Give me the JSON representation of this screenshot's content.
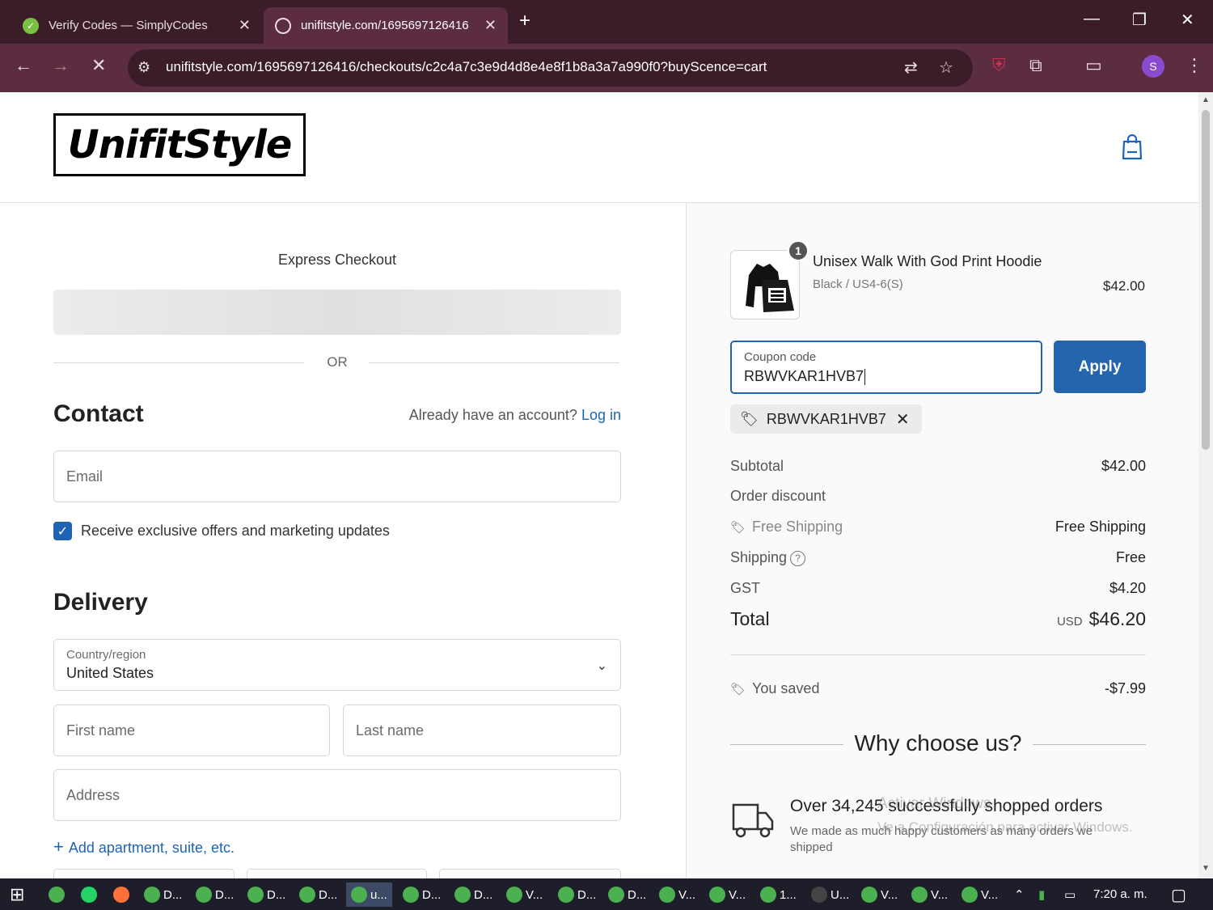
{
  "browser": {
    "tabs": [
      {
        "title": "Verify Codes — SimplyCodes",
        "active": false
      },
      {
        "title": "unifitstyle.com/1695697126416",
        "active": true
      }
    ],
    "new_tab": "+",
    "url": "unifitstyle.com/1695697126416/checkouts/c2c4a7c3e9d4d8e4e8f1b8a3a7a990f0?buyScence=cart",
    "profile_initial": "S"
  },
  "header": {
    "logo_text": "UnifitStyle"
  },
  "checkout": {
    "express_label": "Express Checkout",
    "or_label": "OR",
    "contact_heading": "Contact",
    "login_prompt": "Already have an account?",
    "login_link": "Log in",
    "email_placeholder": "Email",
    "marketing_label": "Receive exclusive offers and marketing updates",
    "delivery_heading": "Delivery",
    "country_label": "Country/region",
    "country_value": "United States",
    "first_name_placeholder": "First name",
    "last_name_placeholder": "Last name",
    "address_placeholder": "Address",
    "add_apartment": "Add apartment, suite, etc."
  },
  "summary": {
    "item": {
      "quantity": "1",
      "name": "Unisex Walk With God Print Hoodie",
      "variant": "Black / US4-6(S)",
      "price": "$42.00"
    },
    "coupon_label": "Coupon code",
    "coupon_value": "RBWVKAR1HVB7",
    "apply_label": "Apply",
    "applied_code": "RBWVKAR1HVB7",
    "subtotal_label": "Subtotal",
    "subtotal_value": "$42.00",
    "order_discount_label": "Order discount",
    "free_shipping_label": "Free Shipping",
    "free_shipping_value": "Free Shipping",
    "shipping_label": "Shipping",
    "shipping_value": "Free",
    "gst_label": "GST",
    "gst_value": "$4.20",
    "total_label": "Total",
    "total_currency": "USD",
    "total_value": "$46.20",
    "saved_label": "You saved",
    "saved_value": "-$7.99",
    "why_heading": "Why choose us?",
    "feature_title": "Over 34,245 successfully shopped orders",
    "feature_desc": "We made as much happy customers as many orders we shipped"
  },
  "overlay": {
    "watermark_line1": "Activar Windows",
    "watermark_line2": "Ve a Configuración para activar Windows."
  },
  "taskbar": {
    "items": [
      "D...",
      "D...",
      "D...",
      "D...",
      "u...",
      "D...",
      "D...",
      "V...",
      "D...",
      "D...",
      "V...",
      "V...",
      "1...",
      "U...",
      "V...",
      "V...",
      "V..."
    ],
    "time": "7:20 a. m."
  },
  "colors": {
    "accent": "#2465ae",
    "chrome_dark": "#3b1d2a",
    "chrome_tab": "#5c2c40"
  }
}
